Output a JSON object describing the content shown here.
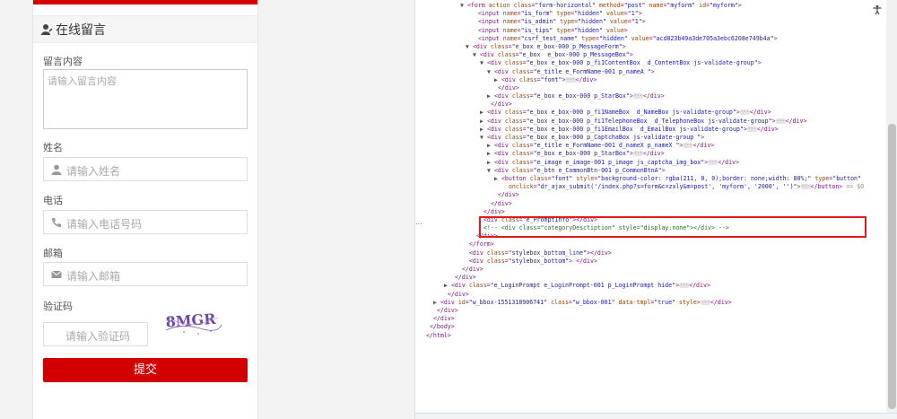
{
  "form": {
    "header_title": "在线留言",
    "message_label": "留言内容",
    "message_placeholder": "请输入留言内容",
    "name_label": "姓名",
    "name_placeholder": "请输入姓名",
    "phone_label": "电话",
    "phone_placeholder": "请输入电话号码",
    "email_label": "邮箱",
    "email_placeholder": "请输入邮箱",
    "captcha_label": "验证码",
    "captcha_placeholder": "请输入验证码",
    "captcha_image_text": "8MGR",
    "submit_label": "提交",
    "accent_color": "#d30000"
  },
  "devtools": {
    "gutter_ellipsis": "...",
    "accessibility_icon": "accessibility-icon",
    "lines": [
      {
        "indent": 50,
        "t": "▼",
        "parts": [
          [
            "tag",
            "<form "
          ],
          [
            "attr",
            "action class"
          ],
          [
            "tag",
            "="
          ],
          [
            "val",
            "\"form-horizontal\""
          ],
          [
            "attr",
            " method"
          ],
          [
            "tag",
            "="
          ],
          [
            "val",
            "\"post\""
          ],
          [
            "attr",
            " name"
          ],
          [
            "tag",
            "="
          ],
          [
            "val",
            "\"myform\""
          ],
          [
            "attr",
            " id"
          ],
          [
            "tag",
            "="
          ],
          [
            "val",
            "\"myform\""
          ],
          [
            "tag",
            ">"
          ]
        ]
      },
      {
        "indent": 62,
        "t": "",
        "parts": [
          [
            "tag",
            "<input "
          ],
          [
            "attr",
            "name"
          ],
          [
            "tag",
            "="
          ],
          [
            "val",
            "\"is_form\""
          ],
          [
            "attr",
            " type"
          ],
          [
            "tag",
            "="
          ],
          [
            "val",
            "\"hidden\""
          ],
          [
            "attr",
            " value"
          ],
          [
            "tag",
            "="
          ],
          [
            "val",
            "\"1\""
          ],
          [
            "tag",
            ">"
          ]
        ]
      },
      {
        "indent": 62,
        "t": "",
        "parts": [
          [
            "tag",
            "<input "
          ],
          [
            "attr",
            "name"
          ],
          [
            "tag",
            "="
          ],
          [
            "val",
            "\"is_admin\""
          ],
          [
            "attr",
            " type"
          ],
          [
            "tag",
            "="
          ],
          [
            "val",
            "\"hidden\""
          ],
          [
            "attr",
            " value"
          ],
          [
            "tag",
            "="
          ],
          [
            "val",
            "\"1\""
          ],
          [
            "tag",
            ">"
          ]
        ]
      },
      {
        "indent": 62,
        "t": "",
        "parts": [
          [
            "tag",
            "<input "
          ],
          [
            "attr",
            "name"
          ],
          [
            "tag",
            "="
          ],
          [
            "val",
            "\"is_tips\""
          ],
          [
            "attr",
            " type"
          ],
          [
            "tag",
            "="
          ],
          [
            "val",
            "\"hidden\""
          ],
          [
            "attr",
            " value"
          ],
          [
            "tag",
            ">"
          ]
        ]
      },
      {
        "indent": 62,
        "t": "",
        "parts": [
          [
            "tag",
            "<input "
          ],
          [
            "attr",
            "name"
          ],
          [
            "tag",
            "="
          ],
          [
            "val",
            "\"csrf_test_name\""
          ],
          [
            "attr",
            " type"
          ],
          [
            "tag",
            "="
          ],
          [
            "val",
            "\"hidden\""
          ],
          [
            "attr",
            " value"
          ],
          [
            "tag",
            "="
          ],
          [
            "val",
            "\"acd823b49a3de705a3ebc6208e749b4a\""
          ],
          [
            "tag",
            ">"
          ]
        ]
      },
      {
        "indent": 56,
        "t": "▼",
        "parts": [
          [
            "tag",
            "<div "
          ],
          [
            "attr",
            "class"
          ],
          [
            "tag",
            "="
          ],
          [
            "val",
            "\"e_box e_box-000 p_MessageForm\""
          ],
          [
            "tag",
            ">"
          ]
        ]
      },
      {
        "indent": 64,
        "t": "▼",
        "parts": [
          [
            "tag",
            "<div "
          ],
          [
            "attr",
            "class"
          ],
          [
            "tag",
            "="
          ],
          [
            "val",
            "\"e_box  e_box-000 p_MessageBox\""
          ],
          [
            "tag",
            ">"
          ]
        ]
      },
      {
        "indent": 72,
        "t": "▼",
        "parts": [
          [
            "tag",
            "<div "
          ],
          [
            "attr",
            "class"
          ],
          [
            "tag",
            "="
          ],
          [
            "val",
            "\"e_box e_box-000 p_fi1ContentBox  d_ContentBox js-validate-group\""
          ],
          [
            "tag",
            ">"
          ]
        ]
      },
      {
        "indent": 80,
        "t": "▼",
        "parts": [
          [
            "tag",
            "<div "
          ],
          [
            "attr",
            "class"
          ],
          [
            "tag",
            "="
          ],
          [
            "val",
            "\"e_title e_FormName-001 p_nameA \""
          ],
          [
            "tag",
            ">"
          ]
        ]
      },
      {
        "indent": 88,
        "t": "▶",
        "parts": [
          [
            "tag",
            "<div "
          ],
          [
            "attr",
            "class"
          ],
          [
            "tag",
            "="
          ],
          [
            "val",
            "\"font\""
          ],
          [
            "tag",
            ">"
          ],
          [
            "dots",
            "···"
          ],
          [
            "tag",
            "</div>"
          ]
        ]
      },
      {
        "indent": 84,
        "t": "",
        "parts": [
          [
            "tag",
            "</div>"
          ]
        ]
      },
      {
        "indent": 80,
        "t": "▶",
        "parts": [
          [
            "tag",
            "<div "
          ],
          [
            "attr",
            "class"
          ],
          [
            "tag",
            "="
          ],
          [
            "val",
            "\"e_box e_box-000 p_StarBox\""
          ],
          [
            "tag",
            ">"
          ],
          [
            "dots",
            "···"
          ],
          [
            "tag",
            "</div>"
          ]
        ]
      },
      {
        "indent": 76,
        "t": "",
        "parts": [
          [
            "tag",
            "</div>"
          ]
        ]
      },
      {
        "indent": 72,
        "t": "▶",
        "parts": [
          [
            "tag",
            "<div "
          ],
          [
            "attr",
            "class"
          ],
          [
            "tag",
            "="
          ],
          [
            "val",
            "\"e_box e_box-000 p_fi1NameBox  d_NameBox js-validate-group\""
          ],
          [
            "tag",
            ">"
          ],
          [
            "dots",
            "···"
          ],
          [
            "tag",
            "</div>"
          ]
        ]
      },
      {
        "indent": 72,
        "t": "▶",
        "parts": [
          [
            "tag",
            "<div "
          ],
          [
            "attr",
            "class"
          ],
          [
            "tag",
            "="
          ],
          [
            "val",
            "\"e_box e_box-000 p_fi1TelephoneBox  d_TelephoneBox js-validate-group\""
          ],
          [
            "tag",
            ">"
          ],
          [
            "dots",
            "···"
          ],
          [
            "tag",
            "</div>"
          ]
        ]
      },
      {
        "indent": 72,
        "t": "▶",
        "parts": [
          [
            "tag",
            "<div "
          ],
          [
            "attr",
            "class"
          ],
          [
            "tag",
            "="
          ],
          [
            "val",
            "\"e_box e_box-000 p_fi1EmailBox  d_EmailBox js-validate-group\""
          ],
          [
            "tag",
            ">"
          ],
          [
            "dots",
            "···"
          ],
          [
            "tag",
            "</div>"
          ]
        ]
      },
      {
        "indent": 72,
        "t": "▼",
        "parts": [
          [
            "tag",
            "<div "
          ],
          [
            "attr",
            "class"
          ],
          [
            "tag",
            "="
          ],
          [
            "val",
            "\"e_box e_box-000 p_CaptchaBox js-validate-group \""
          ],
          [
            "tag",
            ">"
          ]
        ]
      },
      {
        "indent": 80,
        "t": "▶",
        "parts": [
          [
            "tag",
            "<div "
          ],
          [
            "attr",
            "class"
          ],
          [
            "tag",
            "="
          ],
          [
            "val",
            "\"e_title e_FormName-001 d_nameX p_nameX \""
          ],
          [
            "tag",
            ">"
          ],
          [
            "dots",
            "···"
          ],
          [
            "tag",
            "</div>"
          ]
        ]
      },
      {
        "indent": 80,
        "t": "▶",
        "parts": [
          [
            "tag",
            "<div "
          ],
          [
            "attr",
            "class"
          ],
          [
            "tag",
            "="
          ],
          [
            "val",
            "\"e_box e_box-000 p_StarBox\""
          ],
          [
            "tag",
            ">"
          ],
          [
            "dots",
            "···"
          ],
          [
            "tag",
            "</div>"
          ]
        ]
      },
      {
        "indent": 80,
        "t": "▶",
        "parts": [
          [
            "tag",
            "<div "
          ],
          [
            "attr",
            "class"
          ],
          [
            "tag",
            "="
          ],
          [
            "val",
            "\"e_image e_image-001 p_image js_captcha_img_box\""
          ],
          [
            "tag",
            ">"
          ],
          [
            "dots",
            "···"
          ],
          [
            "tag",
            "</div>"
          ]
        ]
      },
      {
        "indent": 80,
        "t": "▼",
        "parts": [
          [
            "tag",
            "<div "
          ],
          [
            "attr",
            "class"
          ],
          [
            "tag",
            "="
          ],
          [
            "val",
            "\"e_btn e_CommonBtn-001 p_CommonBtnA\""
          ],
          [
            "tag",
            ">"
          ]
        ]
      },
      {
        "indent": 88,
        "t": "▶",
        "parts": [
          [
            "tag",
            "<button "
          ],
          [
            "attr",
            "class"
          ],
          [
            "tag",
            "="
          ],
          [
            "val",
            "\"font\""
          ],
          [
            "attr",
            " style"
          ],
          [
            "tag",
            "="
          ],
          [
            "val",
            "\"background-color: rgba(211, 0, 0);border: none;width: 80%;\""
          ],
          [
            "attr",
            " type"
          ],
          [
            "tag",
            "="
          ],
          [
            "val",
            "\"button\""
          ]
        ]
      },
      {
        "indent": 96,
        "t": "",
        "parts": [
          [
            "attr",
            "onclick"
          ],
          [
            "tag",
            "="
          ],
          [
            "val",
            "\"dr_ajax_submit('/index.php?s=form&c=zxly&m=post', 'myform', '2000', '')\""
          ],
          [
            "tag",
            ">"
          ],
          [
            "dots",
            "···"
          ],
          [
            "tag",
            "</button>"
          ],
          [
            "eq",
            " == $0"
          ]
        ]
      },
      {
        "indent": 84,
        "t": "",
        "parts": [
          [
            "tag",
            "</div>"
          ]
        ]
      },
      {
        "indent": 76,
        "t": "",
        "parts": [
          [
            "tag",
            "</div>"
          ]
        ]
      },
      {
        "indent": 68,
        "t": "",
        "parts": [
          [
            "tag",
            "</div>"
          ]
        ]
      },
      {
        "indent": 68,
        "t": "",
        "parts": [
          [
            "tag",
            "<div "
          ],
          [
            "attr",
            "class"
          ],
          [
            "tag",
            "="
          ],
          [
            "val",
            "\"e_PromptInfo\""
          ],
          [
            "tag",
            "></div>"
          ]
        ]
      },
      {
        "indent": 68,
        "t": "",
        "parts": [
          [
            "cmt",
            "<!-- <div class=\"categoryDesctiption\" style=\"display:none\"></div> -->"
          ]
        ]
      },
      {
        "indent": 60,
        "t": "",
        "parts": [
          [
            "tag",
            "</div>"
          ]
        ]
      },
      {
        "indent": 52,
        "t": "",
        "parts": [
          [
            "tag",
            "</form>"
          ]
        ]
      },
      {
        "indent": 52,
        "t": "",
        "parts": [
          [
            "tag",
            "<div "
          ],
          [
            "attr",
            "class"
          ],
          [
            "tag",
            "="
          ],
          [
            "val",
            "\"stylebox_bottom_line\""
          ],
          [
            "tag",
            "></div>"
          ]
        ]
      },
      {
        "indent": 52,
        "t": "",
        "parts": [
          [
            "tag",
            "<div "
          ],
          [
            "attr",
            "class"
          ],
          [
            "tag",
            "="
          ],
          [
            "val",
            "\"stylebox_bottom\""
          ],
          [
            "tag",
            "> </div>"
          ]
        ]
      },
      {
        "indent": 44,
        "t": "",
        "parts": [
          [
            "tag",
            "</div>"
          ]
        ]
      },
      {
        "indent": 36,
        "t": "",
        "parts": [
          [
            "tag",
            "</div>"
          ]
        ]
      },
      {
        "indent": 32,
        "t": "▶",
        "parts": [
          [
            "tag",
            "<div "
          ],
          [
            "attr",
            "class"
          ],
          [
            "tag",
            "="
          ],
          [
            "val",
            "\"e_LoginPrompt e_LoginPrompt-001 p_LoginPrompt hide\""
          ],
          [
            "tag",
            ">"
          ],
          [
            "dots",
            "···"
          ],
          [
            "tag",
            "</div>"
          ]
        ]
      },
      {
        "indent": 28,
        "t": "",
        "parts": [
          [
            "tag",
            "</div>"
          ]
        ]
      },
      {
        "indent": 20,
        "t": "▶",
        "parts": [
          [
            "tag",
            "<div "
          ],
          [
            "attr",
            "id"
          ],
          [
            "tag",
            "="
          ],
          [
            "val",
            "\"w_bbox-1551318906741\""
          ],
          [
            "attr",
            " class"
          ],
          [
            "tag",
            "="
          ],
          [
            "val",
            "\"w_bbox-001\""
          ],
          [
            "attr",
            " data-tmpl"
          ],
          [
            "tag",
            "="
          ],
          [
            "val",
            "\"true\""
          ],
          [
            "attr",
            " style"
          ],
          [
            "tag",
            ">"
          ],
          [
            "dots",
            "···"
          ],
          [
            "tag",
            "</div>"
          ]
        ]
      },
      {
        "indent": 16,
        "t": "",
        "parts": [
          [
            "tag",
            "</div>"
          ]
        ]
      },
      {
        "indent": 12,
        "t": "",
        "parts": [
          [
            "tag",
            "</div>"
          ]
        ]
      },
      {
        "indent": 8,
        "t": "",
        "parts": [
          [
            "tag",
            "</body>"
          ]
        ]
      },
      {
        "indent": 4,
        "t": "",
        "parts": [
          [
            "tag",
            "</html>"
          ]
        ]
      }
    ]
  }
}
